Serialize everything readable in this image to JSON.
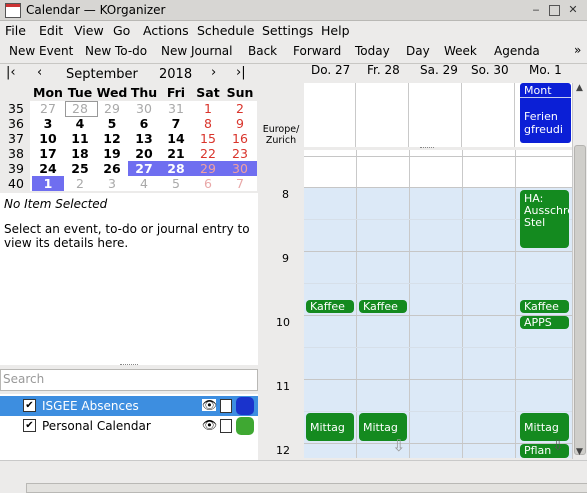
{
  "window": {
    "title": "Calendar  — KOrganizer"
  },
  "menu": [
    "File",
    "Edit",
    "View",
    "Go",
    "Actions",
    "Schedule",
    "Settings",
    "Help"
  ],
  "toolbar": {
    "new_event": "New Event",
    "new_todo": "New To-do",
    "new_journal": "New Journal",
    "back": "Back",
    "forward": "Forward",
    "today": "Today",
    "day": "Day",
    "week": "Week",
    "agenda": "Agenda",
    "overflow": "»"
  },
  "navigator": {
    "first": "|‹",
    "prev": "‹",
    "month": "September",
    "year": "2018",
    "next": "›",
    "last": "›|",
    "weekdays": [
      "Mon",
      "Tue",
      "Wed",
      "Thu",
      "Fri",
      "Sat",
      "Sun"
    ],
    "weeks": [
      {
        "wk": "35",
        "days": [
          "27",
          "28",
          "29",
          "30",
          "31",
          "1",
          "2"
        ]
      },
      {
        "wk": "36",
        "days": [
          "3",
          "4",
          "5",
          "6",
          "7",
          "8",
          "9"
        ]
      },
      {
        "wk": "37",
        "days": [
          "10",
          "11",
          "12",
          "13",
          "14",
          "15",
          "16"
        ]
      },
      {
        "wk": "38",
        "days": [
          "17",
          "18",
          "19",
          "20",
          "21",
          "22",
          "23"
        ]
      },
      {
        "wk": "39",
        "days": [
          "24",
          "25",
          "26",
          "27",
          "28",
          "29",
          "30"
        ]
      },
      {
        "wk": "40",
        "days": [
          "1",
          "2",
          "3",
          "4",
          "5",
          "6",
          "7"
        ]
      }
    ]
  },
  "details": {
    "heading": "No Item Selected",
    "text": "Select an event, to-do or journal entry to view its details here."
  },
  "search": {
    "placeholder": "Search"
  },
  "calendars": [
    {
      "name": "ISGEE Absences",
      "color": "#1a33cc",
      "selected": true
    },
    {
      "name": "Personal Calendar",
      "color": "#3fa832",
      "selected": false
    }
  ],
  "agenda": {
    "timezone": "Europe/\nZurich",
    "days": [
      "Do. 27",
      "Fr. 28",
      "Sa. 29",
      "So. 30",
      "Mo. 1"
    ],
    "hours": [
      "8",
      "9",
      "10",
      "11",
      "12"
    ],
    "allday_event": {
      "title": "Mont",
      "body": "Ferien gfreudi"
    },
    "events": {
      "ha": "HA: Ausschreibung Stel",
      "kaffee": "Kaffee",
      "apps": "APPS",
      "mittag": "Mittag",
      "pflan": "Pflan"
    }
  }
}
